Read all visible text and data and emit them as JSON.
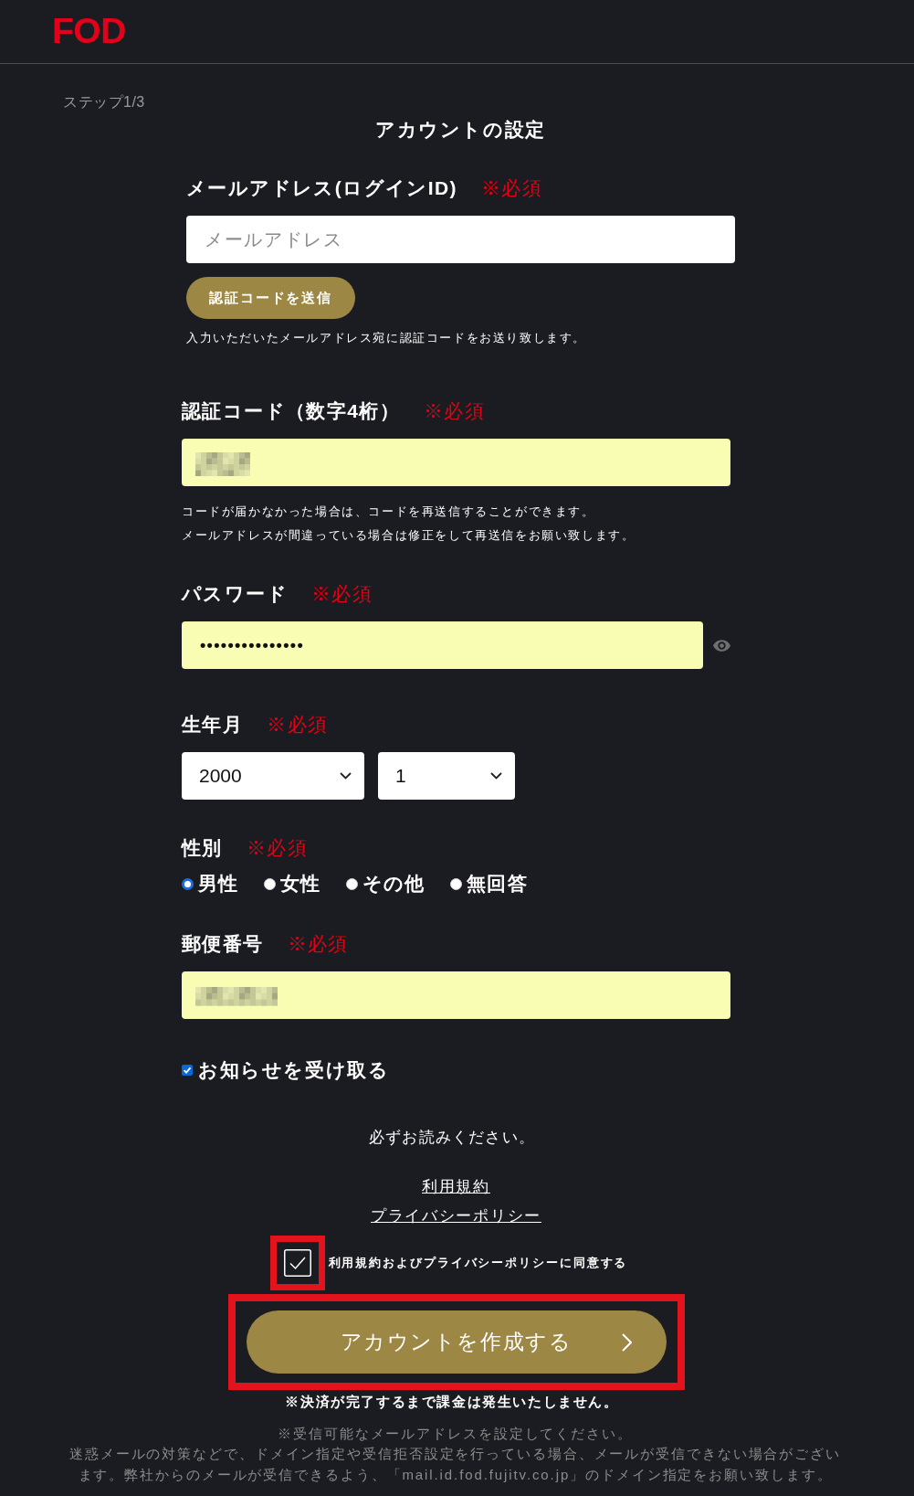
{
  "header": {
    "logo": "FOD"
  },
  "step": "ステップ1/3",
  "title": "アカウントの設定",
  "fields": [
    {
      "kind": "text",
      "label": "メールアドレス(ログインID)",
      "required_label": "※必須",
      "placeholder": "メールアドレス",
      "filled": false,
      "action": "認証コードを送信",
      "notes": [
        "入力いただいたメールアドレス宛に認証コードをお送り致します。"
      ]
    },
    {
      "kind": "text",
      "label": "認証コード（数字4桁）",
      "required_label": "※必須",
      "filled": true,
      "redacted": true,
      "notes": [
        "コードが届かなかった場合は、コードを再送信することができます。",
        "メールアドレスが間違っている場合は修正をして再送信をお願い致します。"
      ]
    },
    {
      "kind": "password",
      "label": "パスワード",
      "required_label": "※必須",
      "filled": true,
      "value": "•••••••••••••••"
    },
    {
      "kind": "selects",
      "label": "生年月",
      "required_label": "※必須",
      "selects": [
        {
          "value": "2000"
        },
        {
          "value": "1"
        }
      ]
    },
    {
      "kind": "radios",
      "label": "性別",
      "required_label": "※必須",
      "options": [
        {
          "label": "男性",
          "selected": true
        },
        {
          "label": "女性",
          "selected": false
        },
        {
          "label": "その他",
          "selected": false
        },
        {
          "label": "無回答",
          "selected": false
        }
      ]
    },
    {
      "kind": "text",
      "label": "郵便番号",
      "required_label": "※必須",
      "filled": true,
      "redacted": true
    }
  ],
  "newsletter": {
    "label": "お知らせを受け取る",
    "checked": true
  },
  "notice": "必ずお読みください。",
  "links": [
    "利用規約",
    "プライバシーポリシー"
  ],
  "agreement": {
    "label": "利用規約およびプライバシーポリシーに同意する",
    "checked": true,
    "highlighted": true
  },
  "submit": {
    "label": "アカウントを作成する",
    "highlighted": true
  },
  "billing_note": "※決済が完了するまで課金は発生いたしません。",
  "mail_notes": [
    "※受信可能なメールアドレスを設定してください。",
    "迷惑メールの対策などで、ドメイン指定や受信拒否設定を行っている場合、メールが受信できない場合がございます。弊社からのメールが受信できるよう、「mail.id.fod.fujitv.co.jp」のドメイン指定をお願い致します。"
  ]
}
